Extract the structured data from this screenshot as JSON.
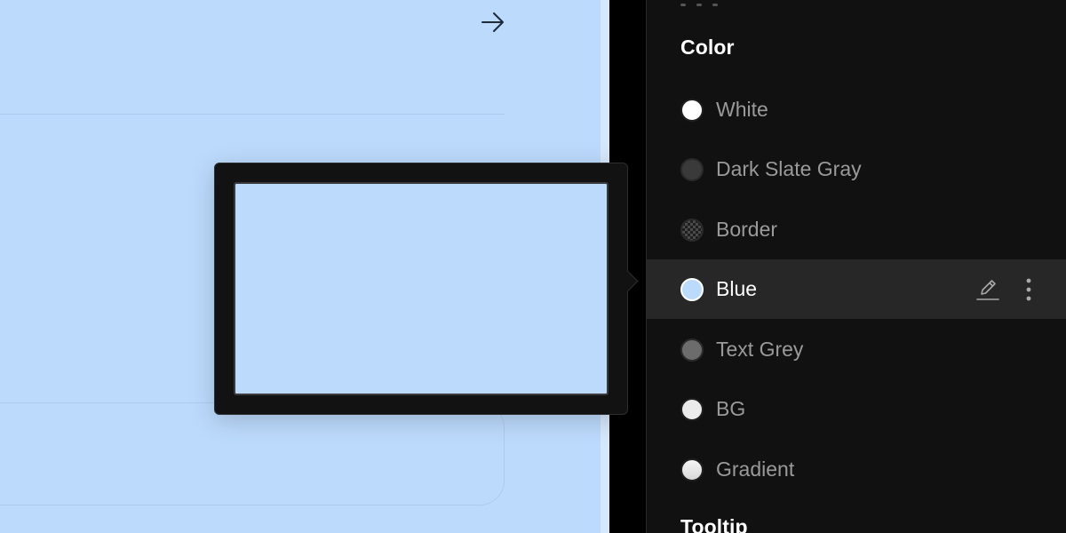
{
  "colors": {
    "canvas_bg": "#bcdafc",
    "panel_bg": "#111111",
    "selected_row_bg": "#272727"
  },
  "panel": {
    "section_color_title": "Color",
    "section_tooltip_title": "Tooltip",
    "items": [
      {
        "label": "White",
        "swatch": "#ffffff"
      },
      {
        "label": "Dark Slate Gray",
        "swatch": "#3a3a3a"
      },
      {
        "label": "Border",
        "swatch": "checker"
      },
      {
        "label": "Blue",
        "swatch": "#bcdafc",
        "selected": true
      },
      {
        "label": "Text Grey",
        "swatch": "#6c6c6c"
      },
      {
        "label": "BG",
        "swatch": "#ebebeb"
      },
      {
        "label": "Gradient",
        "swatch": "#e6e6e6"
      }
    ]
  },
  "preview": {
    "swatch_color": "#bcdafc"
  },
  "icons": {
    "arrow": "arrow-right-icon",
    "edit": "pencil-icon",
    "more": "more-vertical-icon"
  }
}
